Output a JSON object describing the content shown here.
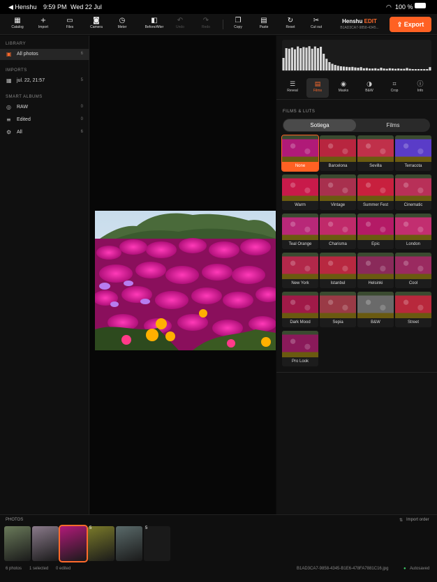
{
  "status_bar": {
    "back_label": "◀ Henshu",
    "time": "9:59 PM",
    "date": "Wed 22 Jul",
    "battery": "100 %"
  },
  "toolbar": {
    "buttons": [
      {
        "label": "Catalog",
        "icon": "catalog-icon"
      },
      {
        "label": "Import",
        "icon": "plus-icon"
      },
      {
        "label": "Files",
        "icon": "folder-icon"
      },
      {
        "label": "Camera",
        "icon": "camera-icon"
      },
      {
        "label": "Meter",
        "icon": "meter-icon"
      },
      {
        "label": "Before/After",
        "icon": "split-icon"
      },
      {
        "label": "Undo",
        "icon": "undo-icon"
      },
      {
        "label": "Redo",
        "icon": "redo-icon"
      },
      {
        "label": "Copy",
        "icon": "copy-icon"
      },
      {
        "label": "Paste",
        "icon": "paste-icon"
      },
      {
        "label": "Reset",
        "icon": "reset-icon"
      },
      {
        "label": "Cut out",
        "icon": "scissors-icon"
      }
    ],
    "app_name": "Henshu",
    "app_edition": "EDIT",
    "doc_id": "B1AD3CA7-9858-4345...",
    "export_label": "Export",
    "accent_color": "#ff6123"
  },
  "sidebar": {
    "library_header": "LIBRARY",
    "library_items": [
      {
        "label": "All photos",
        "count": "6",
        "icon": "photos-icon"
      }
    ],
    "imports_header": "IMPORTS",
    "import_items": [
      {
        "label": "jul. 22, 21:57",
        "count": "5",
        "icon": "calendar-icon"
      }
    ],
    "smart_header": "SMART ALBUMS",
    "smart_items": [
      {
        "label": "RAW",
        "count": "0",
        "icon": "raw-icon"
      },
      {
        "label": "Edited",
        "count": "0",
        "icon": "edited-icon"
      },
      {
        "label": "All",
        "count": "6",
        "icon": "all-icon"
      }
    ]
  },
  "histogram": {
    "bins": [
      0.45,
      0.8,
      0.78,
      0.82,
      0.76,
      0.86,
      0.8,
      0.84,
      0.82,
      0.87,
      0.78,
      0.86,
      0.8,
      0.85,
      0.6,
      0.42,
      0.3,
      0.24,
      0.2,
      0.17,
      0.15,
      0.14,
      0.13,
      0.12,
      0.13,
      0.11,
      0.1,
      0.12,
      0.08,
      0.09,
      0.07,
      0.07,
      0.08,
      0.06,
      0.1,
      0.07,
      0.06,
      0.08,
      0.07,
      0.06,
      0.07,
      0.06,
      0.06,
      0.09,
      0.06,
      0.05,
      0.05,
      0.05,
      0.05,
      0.05,
      0.05,
      0.12
    ]
  },
  "panel_tabs": [
    {
      "label": "Reveal",
      "icon": "sliders-icon"
    },
    {
      "label": "Films",
      "icon": "film-icon"
    },
    {
      "label": "Masks",
      "icon": "mask-icon"
    },
    {
      "label": "B&W",
      "icon": "bw-icon"
    },
    {
      "label": "Crop",
      "icon": "crop-icon"
    },
    {
      "label": "Info",
      "icon": "info-icon"
    }
  ],
  "films": {
    "header": "FILMS & LUTS",
    "segments": [
      "Sotiega",
      "Films"
    ],
    "items": [
      {
        "name": "None",
        "color": "#b01a78"
      },
      {
        "name": "Barcelona",
        "color": "#b8253f"
      },
      {
        "name": "Sevilla",
        "color": "#c0304a"
      },
      {
        "name": "Terracota",
        "color": "#5a3cc8"
      },
      {
        "name": "Warm",
        "color": "#c81a4a"
      },
      {
        "name": "Vintage",
        "color": "#a8304e"
      },
      {
        "name": "Summer Fest",
        "color": "#c8203e"
      },
      {
        "name": "Cinematic",
        "color": "#b83058"
      },
      {
        "name": "Teal Orange",
        "color": "#b82878"
      },
      {
        "name": "Charisma",
        "color": "#c02a6a"
      },
      {
        "name": "Epic",
        "color": "#b41a66"
      },
      {
        "name": "London",
        "color": "#c22e70"
      },
      {
        "name": "New York",
        "color": "#b2284a"
      },
      {
        "name": "Istanbul",
        "color": "#b82840"
      },
      {
        "name": "Helsinki",
        "color": "#8a2a5a"
      },
      {
        "name": "Cool",
        "color": "#9a2a60"
      },
      {
        "name": "Dark Mood",
        "color": "#a01a48"
      },
      {
        "name": "Sepia",
        "color": "#9a3a46"
      },
      {
        "name": "B&W",
        "color": "#6a6a6a"
      },
      {
        "name": "Street",
        "color": "#b8283c"
      },
      {
        "name": "Pro Look",
        "color": "#8a1a5a"
      }
    ]
  },
  "strip": {
    "header": "PHOTOS",
    "import_order": "Import order",
    "thumbs": [
      {
        "color": "#6a7a5a",
        "badge": ""
      },
      {
        "color": "#8a7a8a",
        "badge": ""
      },
      {
        "color": "#b01a78",
        "badge": ""
      },
      {
        "color": "#7a7a2a",
        "badge": "5"
      },
      {
        "color": "#5a6a6a",
        "badge": ""
      },
      {
        "color": "#1a1a1a",
        "badge": "5"
      }
    ],
    "count": "6 photos",
    "selected": "1 selected",
    "edited": "0 edited",
    "filename": "B1AD3CA7-9858-4345-B1E6-478FA7881C16.jpg",
    "autosaved": "Autosaved"
  }
}
